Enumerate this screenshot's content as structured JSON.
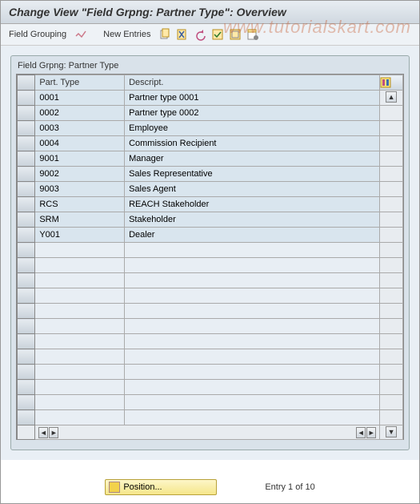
{
  "title": "Change View \"Field Grpng: Partner Type\": Overview",
  "toolbar": {
    "field_grouping_label": "Field Grouping",
    "new_entries_label": "New Entries"
  },
  "watermark": "www.tutorialskart.com",
  "panel": {
    "title": "Field Grpng: Partner Type",
    "columns": {
      "part_type": "Part. Type",
      "descript": "Descript."
    },
    "rows": [
      {
        "type": "0001",
        "desc": "Partner type 0001"
      },
      {
        "type": "0002",
        "desc": "Partner type 0002"
      },
      {
        "type": "0003",
        "desc": "Employee"
      },
      {
        "type": "0004",
        "desc": "Commission Recipient"
      },
      {
        "type": "9001",
        "desc": "Manager"
      },
      {
        "type": "9002",
        "desc": "Sales Representative"
      },
      {
        "type": "9003",
        "desc": "Sales Agent"
      },
      {
        "type": "RCS",
        "desc": "REACH Stakeholder"
      },
      {
        "type": "SRM",
        "desc": "Stakeholder"
      },
      {
        "type": "Y001",
        "desc": "Dealer"
      }
    ],
    "empty_rows": 12
  },
  "footer": {
    "position_label": "Position...",
    "entry_text": "Entry 1 of 10"
  }
}
